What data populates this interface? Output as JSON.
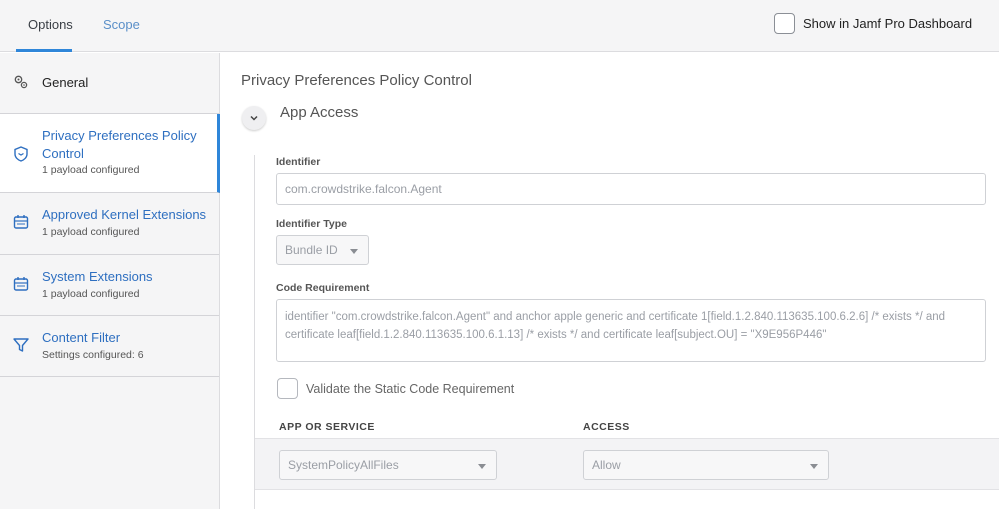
{
  "tabs": {
    "options": "Options",
    "scope": "Scope"
  },
  "dashboard": {
    "label": "Show in Jamf Pro Dashboard"
  },
  "sidebar": {
    "items": [
      {
        "title": "General",
        "icon": "gears-icon"
      },
      {
        "title": "Privacy Preferences Policy Control",
        "subtitle": "1 payload configured",
        "icon": "shield-icon"
      },
      {
        "title": "Approved Kernel Extensions",
        "subtitle": "1 payload configured",
        "icon": "extension-icon"
      },
      {
        "title": "System Extensions",
        "subtitle": "1 payload configured",
        "icon": "extension-icon"
      },
      {
        "title": "Content Filter",
        "subtitle": "Settings configured: 6",
        "icon": "filter-icon"
      }
    ]
  },
  "main": {
    "title": "Privacy Preferences Policy Control",
    "section_title": "App Access",
    "identifier": {
      "label": "Identifier",
      "value": "com.crowdstrike.falcon.Agent"
    },
    "identifier_type": {
      "label": "Identifier Type",
      "value": "Bundle ID"
    },
    "code_requirement": {
      "label": "Code Requirement",
      "value": "identifier \"com.crowdstrike.falcon.Agent\" and anchor apple generic and certificate 1[field.1.2.840.113635.100.6.2.6] /* exists */ and certificate leaf[field.1.2.840.113635.100.6.1.13] /* exists */ and certificate leaf[subject.OU] = \"X9E956P446\""
    },
    "validate_label": "Validate the Static Code Requirement",
    "table": {
      "headers": {
        "app_or_service": "APP OR SERVICE",
        "access": "ACCESS"
      },
      "rows": [
        {
          "service": "SystemPolicyAllFiles",
          "access": "Allow"
        }
      ]
    }
  }
}
